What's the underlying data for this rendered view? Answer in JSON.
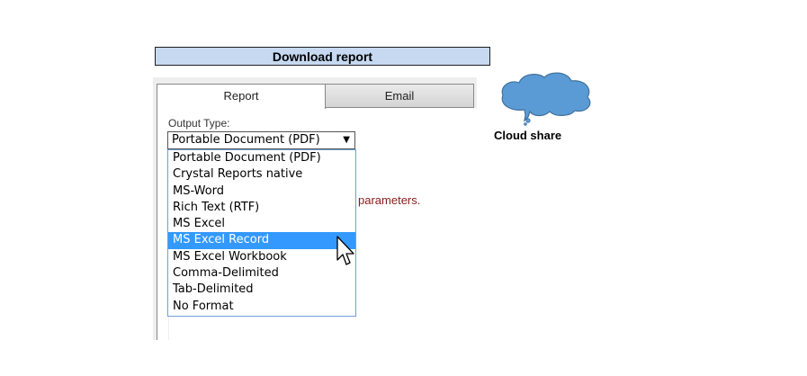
{
  "dialog": {
    "title": "Download report"
  },
  "tabs": [
    {
      "label": "Report",
      "active": true
    },
    {
      "label": "Email",
      "active": false
    }
  ],
  "output_type": {
    "label": "Output Type:",
    "selected_value": "Portable Document (PDF)",
    "arrow": "▼",
    "options": [
      "Portable Document (PDF)",
      "Crystal Reports native",
      "MS-Word",
      "Rich Text (RTF)",
      "MS Excel",
      "MS Excel Record",
      "MS Excel Workbook",
      "Comma-Delimited",
      "Tab-Delimited",
      "No Format"
    ],
    "highlighted_option": "MS Excel Record"
  },
  "partial_message": "parameters.",
  "cloud": {
    "label": "Cloud share",
    "fill_color": "#5b9bd5",
    "icon": "cloud-icon"
  },
  "colors": {
    "title_bar_bg": "#c6d9f1",
    "highlight": "#3399ff",
    "message_text": "#8b1a1a"
  }
}
